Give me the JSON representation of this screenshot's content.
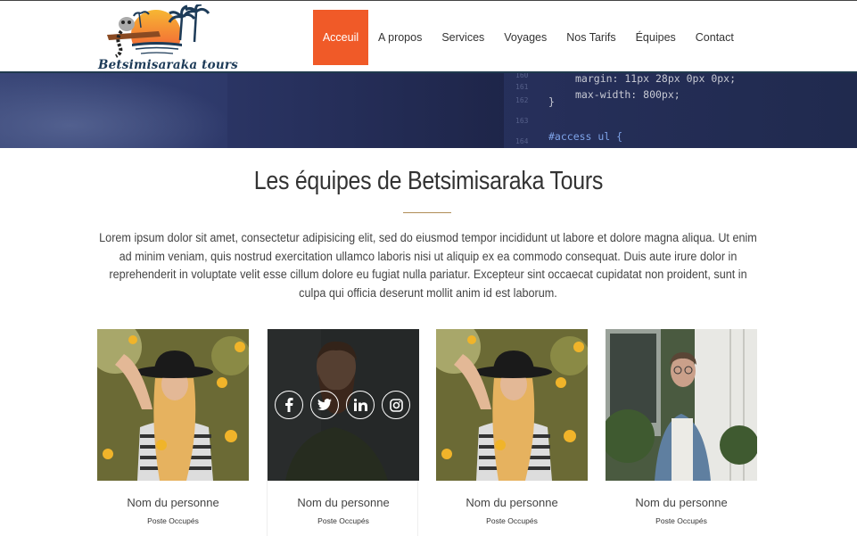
{
  "brand": {
    "name": "Betsimisaraka tours"
  },
  "nav": {
    "items": [
      {
        "label": "Acceuil",
        "active": true
      },
      {
        "label": "A propos",
        "active": false
      },
      {
        "label": "Services",
        "active": false
      },
      {
        "label": "Voyages",
        "active": false
      },
      {
        "label": "Nos Tarifs",
        "active": false
      },
      {
        "label": "Équipes",
        "active": false
      },
      {
        "label": "Contact",
        "active": false
      }
    ]
  },
  "banner": {
    "code_lines": [
      "margin: 11px 28px 0px 0px;",
      "max-width: 800px;",
      "}",
      "#access ul {"
    ],
    "line_numbers": [
      "160",
      "161",
      "162",
      "163",
      "164"
    ]
  },
  "section": {
    "title": "Les équipes de Betsimisaraka Tours",
    "intro": "Lorem ipsum dolor sit amet, consectetur adipisicing elit, sed do eiusmod tempor incididunt ut labore et dolore magna aliqua. Ut enim ad minim veniam, quis nostrud exercitation ullamco laboris nisi ut aliquip ex ea commodo consequat. Duis aute irure dolor in reprehenderit in voluptate velit esse cillum dolore eu fugiat nulla pariatur. Excepteur sint occaecat cupidatat non proident, sunt in culpa qui officia deserunt mollit anim id est laborum."
  },
  "team": [
    {
      "name": "Nom du personne",
      "role": "Poste Occupés",
      "photo": "woman-sunflowers"
    },
    {
      "name": "Nom du personne",
      "role": "Poste Occupés",
      "photo": "bearded-man"
    },
    {
      "name": "Nom du personne",
      "role": "Poste Occupés",
      "photo": "woman-sunflowers"
    },
    {
      "name": "Nom du personne",
      "role": "Poste Occupés",
      "photo": "man-denim-jacket"
    }
  ],
  "socials": [
    "facebook-icon",
    "twitter-icon",
    "linkedin-icon",
    "instagram-icon"
  ],
  "colors": {
    "accent": "#f05a28",
    "divider": "#b08d57",
    "header_border": "#203a4e"
  }
}
